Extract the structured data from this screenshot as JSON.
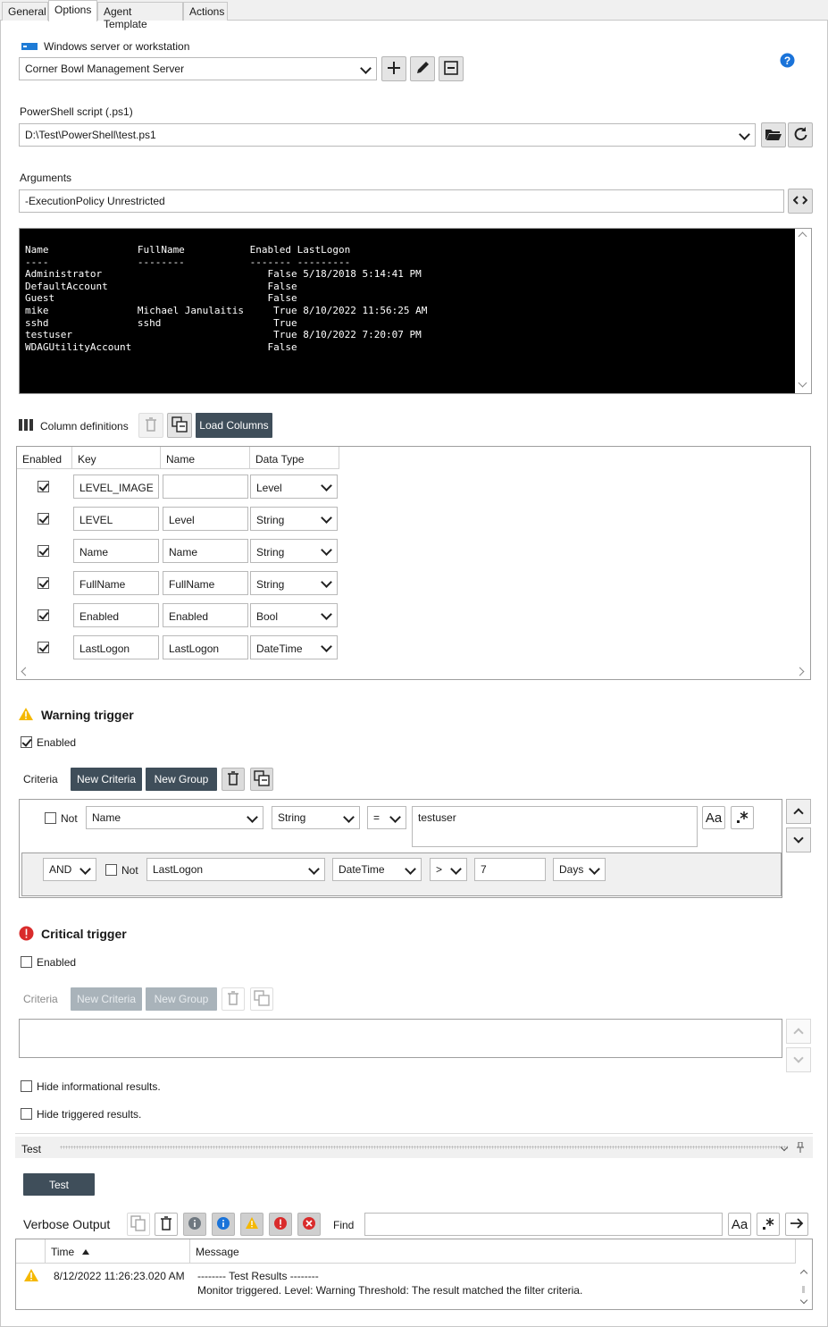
{
  "tabs": [
    "General",
    "Options",
    "Agent Template",
    "Actions"
  ],
  "server": {
    "label": "Windows server or workstation",
    "value": "Corner Bowl Management Server"
  },
  "script": {
    "label": "PowerShell script (.ps1)",
    "value": "D:\\Test\\PowerShell\\test.ps1"
  },
  "arguments": {
    "label": "Arguments",
    "value": "-ExecutionPolicy Unrestricted"
  },
  "console_output": "Name               FullName           Enabled LastLogon\n----               --------           ------- ---------\nAdministrator                            False 5/18/2018 5:14:41 PM\nDefaultAccount                           False\nGuest                                    False\nmike               Michael Janulaitis     True 8/10/2022 11:56:25 AM\nsshd               sshd                   True\ntestuser                                  True 8/10/2022 7:20:07 PM\nWDAGUtilityAccount                       False",
  "columns": {
    "label": "Column definitions",
    "load_button": "Load Columns",
    "headers": [
      "Enabled",
      "Key",
      "Name",
      "Data Type"
    ],
    "rows": [
      {
        "enabled": true,
        "key": "LEVEL_IMAGE",
        "name": "",
        "type": "Level"
      },
      {
        "enabled": true,
        "key": "LEVEL",
        "name": "Level",
        "type": "String"
      },
      {
        "enabled": true,
        "key": "Name",
        "name": "Name",
        "type": "String"
      },
      {
        "enabled": true,
        "key": "FullName",
        "name": "FullName",
        "type": "String"
      },
      {
        "enabled": true,
        "key": "Enabled",
        "name": "Enabled",
        "type": "Bool"
      },
      {
        "enabled": true,
        "key": "LastLogon",
        "name": "LastLogon",
        "type": "DateTime"
      }
    ]
  },
  "warning": {
    "title": "Warning trigger",
    "enabled_label": "Enabled",
    "enabled": true,
    "criteria_label": "Criteria",
    "new_criteria": "New Criteria",
    "new_group": "New Group",
    "row1": {
      "not_label": "Not",
      "field": "Name",
      "type": "String",
      "op": "=",
      "value": "testuser",
      "case_label": "Aa"
    },
    "row2": {
      "join": "AND",
      "not_label": "Not",
      "field": "LastLogon",
      "type": "DateTime",
      "op": ">",
      "value": "7",
      "unit": "Days"
    }
  },
  "critical": {
    "title": "Critical trigger",
    "enabled_label": "Enabled",
    "enabled": false,
    "criteria_label": "Criteria",
    "new_criteria": "New Criteria",
    "new_group": "New Group"
  },
  "options": {
    "hide_info": "Hide informational results.",
    "hide_triggered": "Hide triggered results."
  },
  "test": {
    "panel_title": "Test",
    "button": "Test",
    "verbose_label": "Verbose Output",
    "find_label": "Find",
    "find_value": "",
    "case_label": "Aa",
    "headers": [
      "Time",
      "Message"
    ],
    "rows": [
      {
        "time": "8/12/2022 11:26:23.020 AM",
        "message_line1": "-------- Test Results --------",
        "message_line2": "Monitor triggered.  Level: Warning  Threshold: The result matched the filter criteria."
      }
    ]
  },
  "colors": {
    "accent_dark": "#3f4e5a",
    "help_blue": "#1a73d9",
    "warning": "#f5b800",
    "critical": "#d92b2b"
  }
}
